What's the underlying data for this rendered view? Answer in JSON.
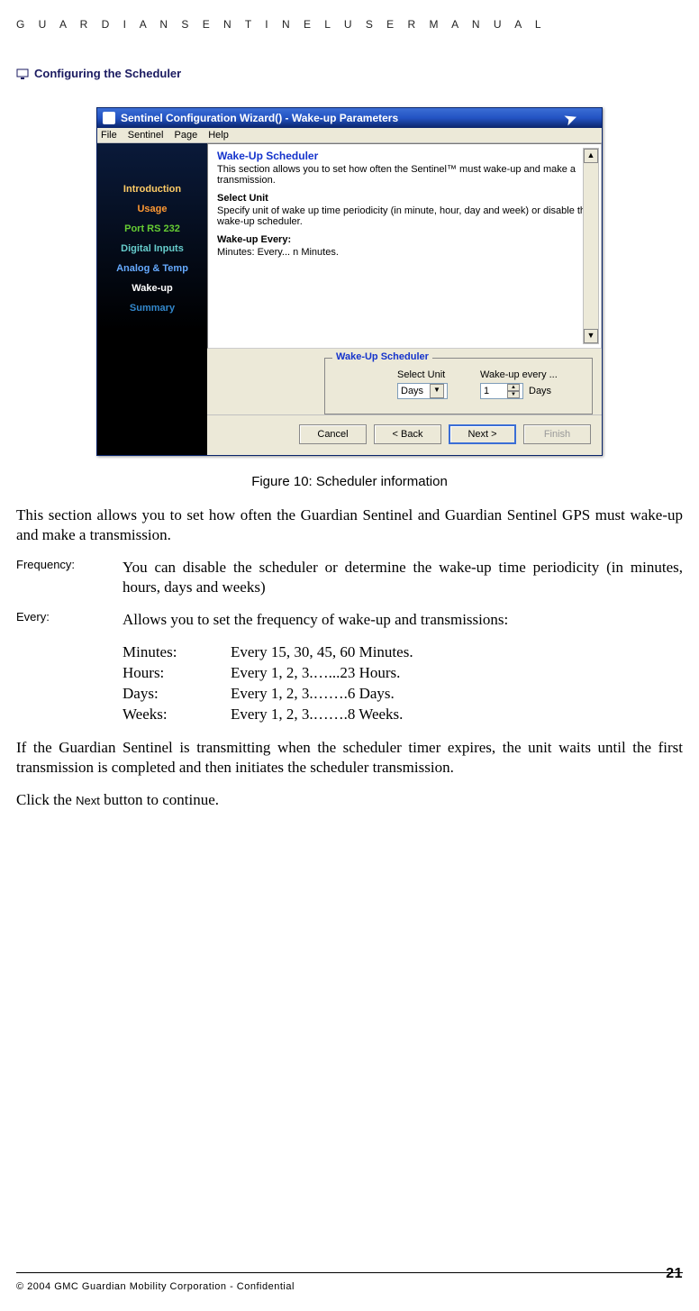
{
  "doc_header": "G U A R D I A N   S E N T I N E L   U S E R   M A N U A L",
  "section_heading": "Configuring the Scheduler",
  "wizard": {
    "title": "Sentinel Configuration Wizard() - Wake-up Parameters",
    "menu": {
      "file": "File",
      "sentinel": "Sentinel",
      "page": "Page",
      "help": "Help"
    },
    "sidebar": {
      "intro": "Introduction",
      "usage": "Usage",
      "port": "Port RS 232",
      "dig": "Digital Inputs",
      "ana": "Analog & Temp",
      "wake": "Wake-up",
      "sum": "Summary"
    },
    "pane": {
      "h1": "Wake-Up Scheduler",
      "p1": "This section allows you to set how often the Sentinel™ must wake-up and make a transmission.",
      "h2": "Select Unit",
      "p2": "Specify unit of wake up time periodicity (in minute, hour, day and week) or disable the wake-up   scheduler.",
      "h3": "Wake-up Every:",
      "p3": "Minutes:  Every... n Minutes."
    },
    "scheduler": {
      "legend": "Wake-Up Scheduler",
      "unit_label": "Select Unit",
      "unit_value": "Days",
      "every_label": "Wake-up every ...",
      "every_value": "1",
      "unit_suffix": "Days"
    },
    "buttons": {
      "cancel": "Cancel",
      "back": "< Back",
      "next": "Next >",
      "finish": "Finish"
    }
  },
  "figure_caption": "Figure 10: Scheduler information",
  "body_p1": "This section allows you to set how often the Guardian Sentinel and Guardian Sentinel GPS must wake-up and make a transmission.",
  "def_frequency": {
    "term": "Frequency:",
    "desc": "You can disable the scheduler or determine the wake-up time periodicity (in minutes, hours, days and weeks)"
  },
  "def_every": {
    "term": "Every:",
    "desc": "Allows you to set the frequency of wake-up and transmissions:"
  },
  "time_table": {
    "minutes_k": "Minutes:",
    "minutes_v": "Every 15, 30, 45, 60 Minutes.",
    "hours_k": "Hours:",
    "hours_v": "Every 1, 2, 3.…...23 Hours.",
    "days_k": "Days:",
    "days_v": "Every 1, 2, 3.…….6 Days.",
    "weeks_k": "Weeks:",
    "weeks_v": "Every 1, 2, 3.…….8 Weeks."
  },
  "body_p2": "If the Guardian Sentinel is transmitting when the scheduler timer expires, the unit waits until the first transmission is completed and then initiates the scheduler transmission.",
  "body_p3_a": "Click the ",
  "body_p3_b": "Next",
  "body_p3_c": " button to continue.",
  "footer_text": "© 2004 GMC Guardian Mobility Corporation - Confidential",
  "page_number": "21"
}
